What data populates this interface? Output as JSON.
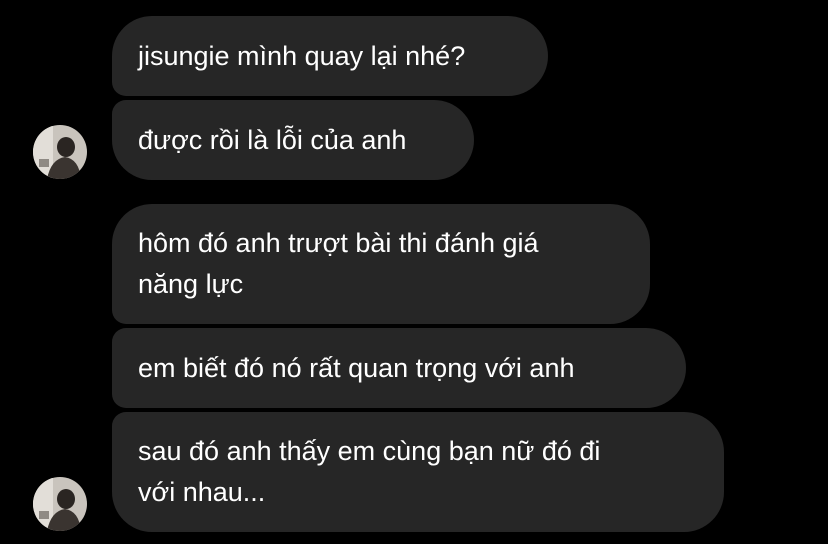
{
  "thread": {
    "messages": [
      {
        "text": "jisungie mình quay lại nhé?"
      },
      {
        "text": "được rồi là lỗi của anh"
      },
      {
        "lines": [
          "hôm đó anh trượt bài thi đánh giá",
          "năng lực"
        ]
      },
      {
        "text": "em biết đó nó rất quan trọng với anh"
      },
      {
        "lines": [
          "sau đó anh thấy em cùng bạn nữ đó đi",
          "với nhau..."
        ]
      }
    ]
  },
  "colors": {
    "background": "#000000",
    "bubble": "#262626",
    "text": "#ffffff"
  },
  "icons": {
    "avatar": "profile-photo"
  }
}
